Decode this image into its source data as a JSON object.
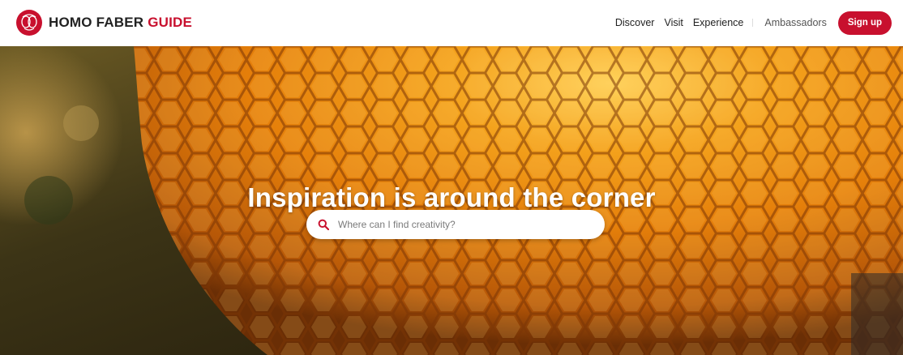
{
  "brand": {
    "part1": "HOMO FABER",
    "part2": "GUIDE",
    "logo_icon": "homo-faber-logo-icon"
  },
  "nav": {
    "items": [
      {
        "label": "Discover"
      },
      {
        "label": "Visit"
      },
      {
        "label": "Experience"
      },
      {
        "label": "Ambassadors"
      }
    ],
    "signup_label": "Sign up"
  },
  "hero": {
    "title": "Inspiration is around the corner",
    "search": {
      "placeholder": "Where can I find creativity?",
      "value": "",
      "icon": "search-icon"
    }
  },
  "colors": {
    "accent": "#c8102e",
    "hero_orange": "#e98a12",
    "text_dark": "#222222"
  }
}
